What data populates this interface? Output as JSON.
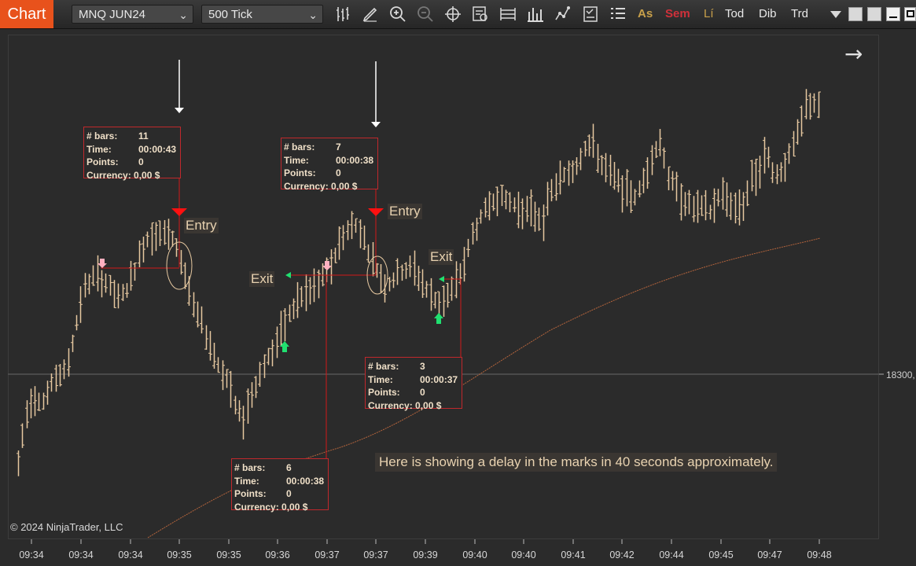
{
  "toolbar": {
    "chart_tab": "Chart",
    "instrument": "MNQ JUN24",
    "interval": "500 Tick",
    "text_buttons": [
      {
        "label": "As",
        "color": "#c8a04a"
      },
      {
        "label": "Sem",
        "color": "#d0303a"
      },
      {
        "label": "Lí",
        "color": "#c8a04a"
      },
      {
        "label": "Tod",
        "color": "#e8e8e8"
      },
      {
        "label": "Dib",
        "color": "#e8e8e8"
      },
      {
        "label": "Trd",
        "color": "#e8e8e8"
      }
    ],
    "icons": [
      "data-series-icon",
      "pencil-icon",
      "zoom-in-icon",
      "zoom-out-icon",
      "crosshair-icon",
      "properties-icon",
      "templates-icon",
      "bar-chart-icon",
      "indicators-icon",
      "strategies-icon",
      "list-icon"
    ]
  },
  "annotations": {
    "entry_label": "Entry",
    "exit_label": "Exit",
    "note": "Here is showing a delay in the marks in 40 seconds approximately.",
    "copyright": "© 2024 NinjaTrader, LLC",
    "price_label": "18300,"
  },
  "info_boxes": [
    {
      "bars_key": "# bars:",
      "bars": "11",
      "time_key": "Time:",
      "time": "00:00:43",
      "points_key": "Points:",
      "points": "0",
      "currency_key": "Currency:",
      "currency": "0,00 $"
    },
    {
      "bars_key": "# bars:",
      "bars": "7",
      "time_key": "Time:",
      "time": "00:00:38",
      "points_key": "Points:",
      "points": "0",
      "currency_key": "Currency:",
      "currency": "0,00 $"
    },
    {
      "bars_key": "# bars:",
      "bars": "3",
      "time_key": "Time:",
      "time": "00:00:37",
      "points_key": "Points:",
      "points": "0",
      "currency_key": "Currency:",
      "currency": "0,00 $"
    },
    {
      "bars_key": "# bars:",
      "bars": "6",
      "time_key": "Time:",
      "time": "00:00:38",
      "points_key": "Points:",
      "points": "0",
      "currency_key": "Currency:",
      "currency": "0,00 $"
    }
  ],
  "x_axis": {
    "ticks": [
      "09:34",
      "09:34",
      "09:34",
      "09:35",
      "09:35",
      "09:36",
      "09:37",
      "09:37",
      "09:39",
      "09:40",
      "09:40",
      "09:41",
      "09:42",
      "09:44",
      "09:45",
      "09:47",
      "09:48"
    ]
  },
  "chart_data": {
    "type": "ohlc",
    "bar_color": "#e6c8a0",
    "ma_color": "#b4643c",
    "marker_colors": {
      "entry": "#ff1010",
      "buy": "#20e070",
      "sell": "#ffb0c0",
      "trade_line": "#d01818"
    }
  }
}
